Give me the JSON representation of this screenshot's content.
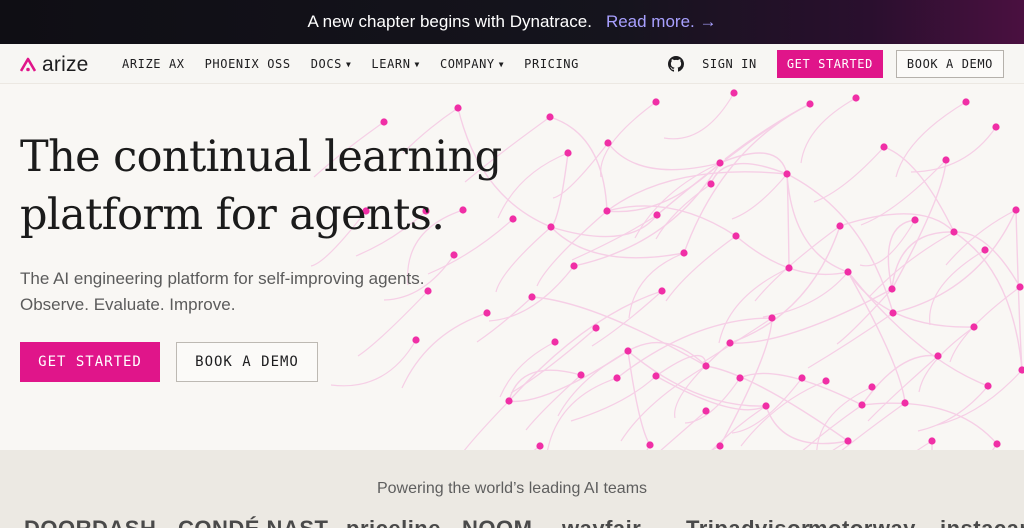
{
  "banner": {
    "message": "A new chapter begins with Dynatrace.",
    "link": "Read more. →"
  },
  "nav": {
    "logo_text": "arize",
    "items": [
      {
        "label": "ARIZE AX",
        "dropdown": false
      },
      {
        "label": "PHOENIX OSS",
        "dropdown": false
      },
      {
        "label": "DOCS",
        "dropdown": true
      },
      {
        "label": "LEARN",
        "dropdown": true
      },
      {
        "label": "COMPANY",
        "dropdown": true
      },
      {
        "label": "PRICING",
        "dropdown": false
      }
    ],
    "caret": "▼",
    "sign_in": "SIGN IN",
    "get_started": "GET STARTED",
    "book_demo": "BOOK A DEMO"
  },
  "hero": {
    "headline_line1": "The continual learning",
    "headline_line2": "platform for agents.",
    "sub_line1": "The AI engineering platform for self-improving agents.",
    "sub_line2": "Observe. Evaluate. Improve.",
    "cta_primary": "GET STARTED",
    "cta_secondary": "BOOK A DEMO"
  },
  "logos": {
    "title": "Powering the world’s leading AI teams",
    "brands": [
      "DOORDASH",
      "CONDÉ NAST",
      "priceline",
      "NOOM",
      "wayfair",
      "Tripadvisor",
      "motorway",
      "instacart"
    ]
  },
  "colors": {
    "accent": "#e0158a",
    "dot": "#f02fa6",
    "line": "#f6cfe6"
  },
  "icons": {
    "logo": "arize-logo-icon",
    "github": "github-icon",
    "caret": "chevron-down-icon"
  }
}
